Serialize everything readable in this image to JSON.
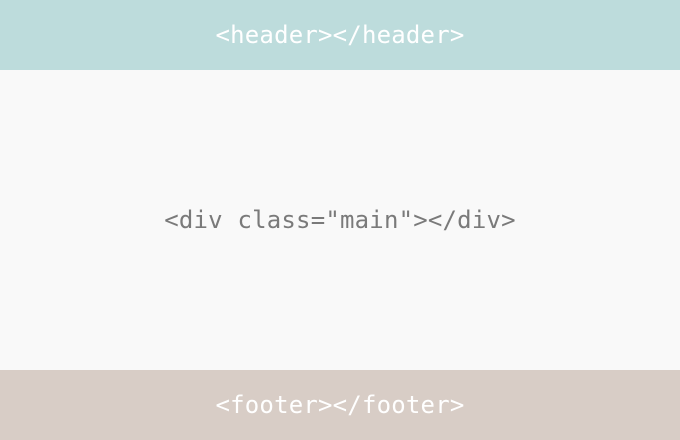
{
  "header": {
    "label": "<header></header>",
    "background": "#bddcdc",
    "text_color": "#ffffff"
  },
  "main": {
    "label": "<div class=\"main\"></div>",
    "background": "#f9f9f9",
    "text_color": "#7a7a7a"
  },
  "footer": {
    "label": "<footer></footer>",
    "background": "#d8cdc6",
    "text_color": "#ffffff"
  }
}
